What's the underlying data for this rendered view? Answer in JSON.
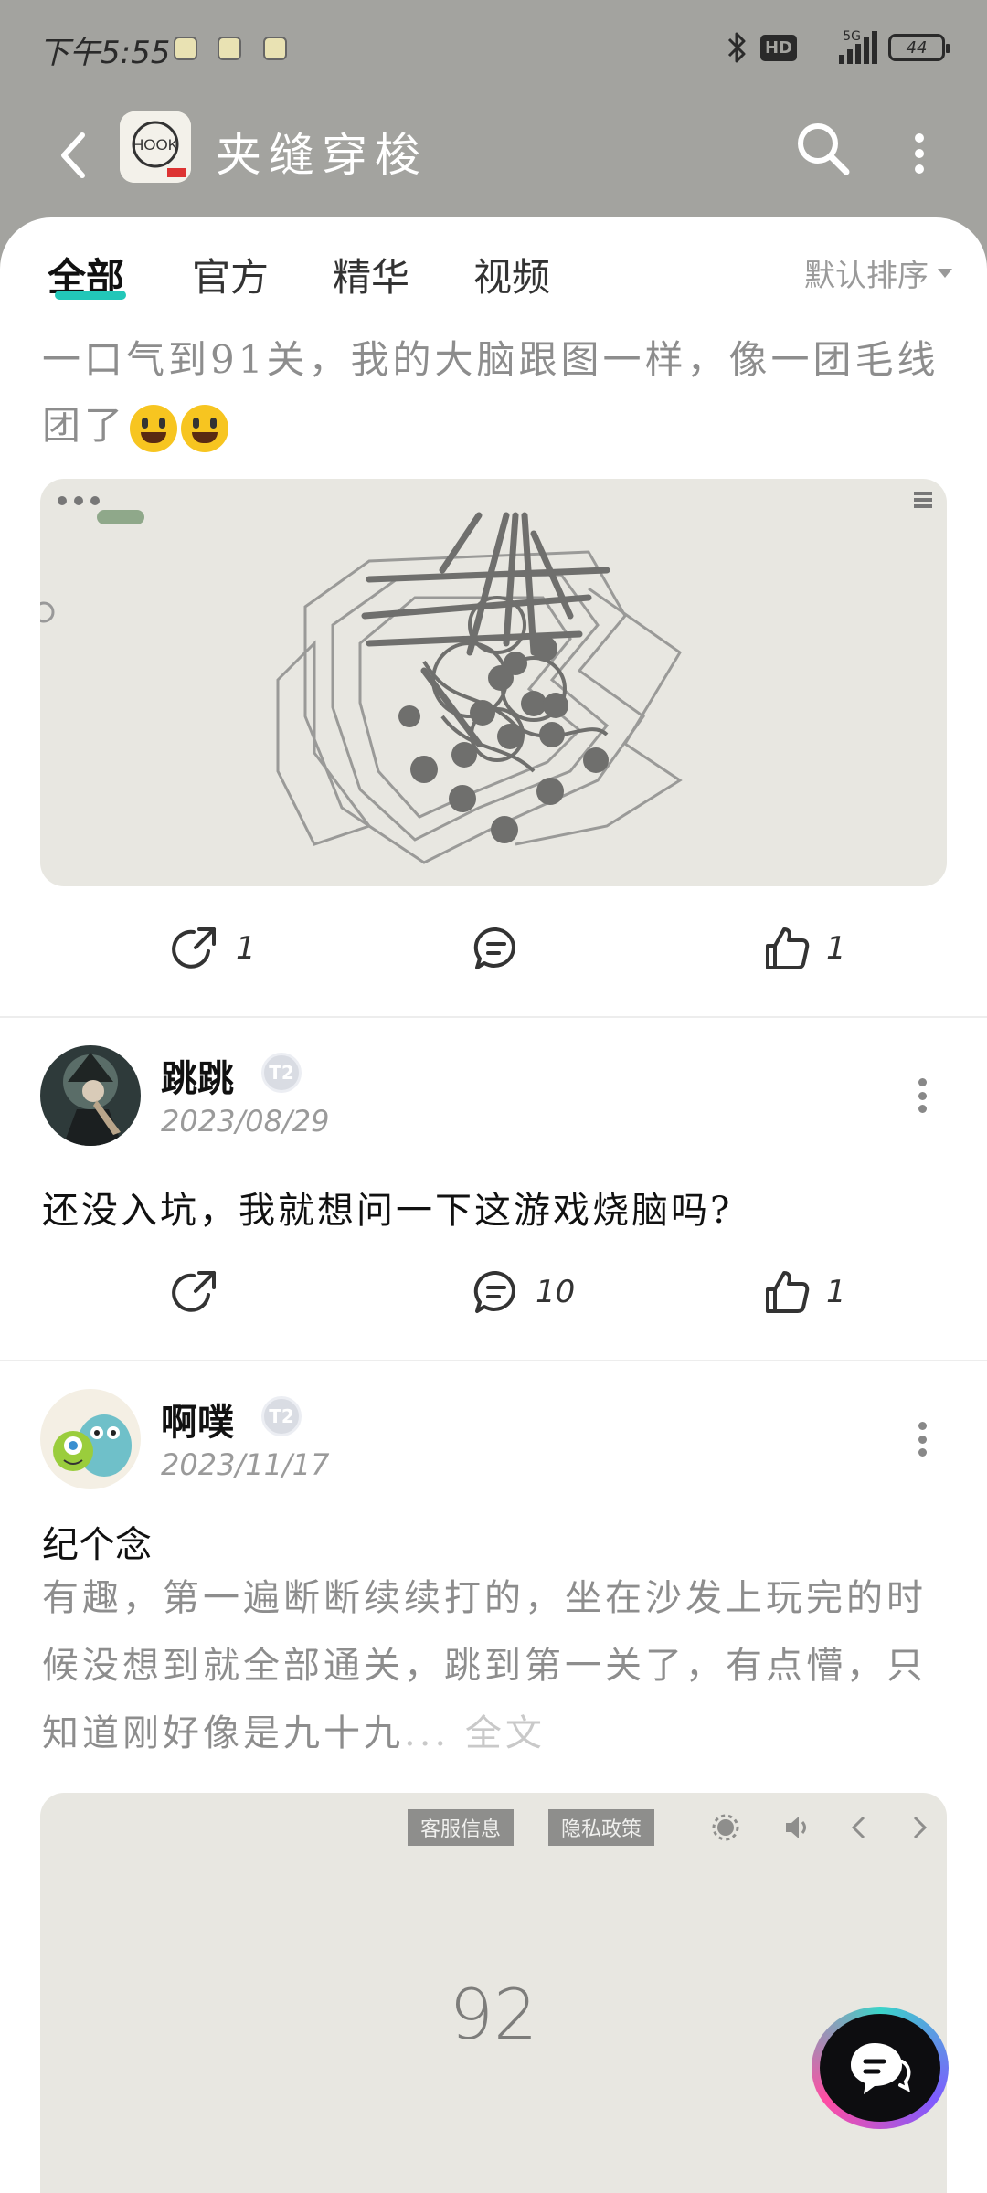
{
  "status_bar": {
    "time": "下午5:55",
    "network": "5G",
    "hd_label": "HD",
    "battery": "44"
  },
  "header": {
    "app_title": "夹缝穿梭",
    "logo_text": "HOOK"
  },
  "tabs": [
    {
      "label": "全部",
      "active": true
    },
    {
      "label": "官方",
      "active": false
    },
    {
      "label": "精华",
      "active": false
    },
    {
      "label": "视频",
      "active": false
    }
  ],
  "sort_label": "默认排序",
  "posts": [
    {
      "text": "一口气到91关，我的大脑跟图一样，像一团毛线团了",
      "share_count": "1",
      "like_count": "1"
    },
    {
      "username": "跳跳",
      "level": "T2",
      "date": "2023/08/29",
      "text": "还没入坑，我就想问一下这游戏烧脑吗?",
      "comment_count": "10",
      "like_count": "1"
    },
    {
      "username": "啊噗",
      "level": "T2",
      "date": "2023/11/17",
      "title": "纪个念",
      "excerpt": "有趣，第一遍断断续续打的，坐在沙发上玩完的时候没想到就全部通关，跳到第一关了，有点懵，只知道刚好像是九十九",
      "more_label": "... 全文",
      "image_buttons": [
        "客服信息",
        "隐私政策"
      ],
      "level_number": "92"
    }
  ],
  "colors": {
    "accent": "#22c7b8",
    "header_bg": "#a3a39f",
    "image_bg": "#e8e7e1"
  }
}
